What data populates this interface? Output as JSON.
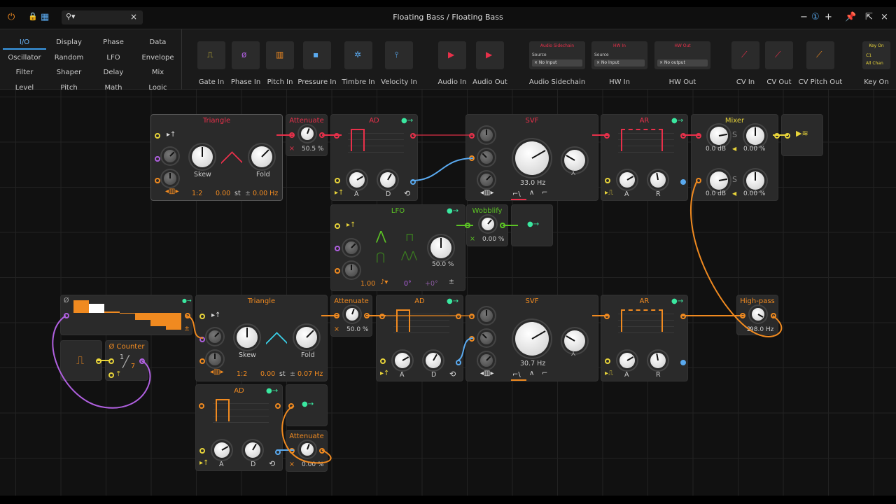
{
  "window": {
    "title": "Floating Bass / Floating Bass",
    "zoom_minus": "−",
    "zoom_plus": "+",
    "close": "×"
  },
  "colors": {
    "red": "#e8304a",
    "orange": "#f08a20",
    "green": "#5cc424",
    "yellow": "#e8d43a",
    "teal": "#3ae8a0",
    "purple": "#b060e0",
    "blue": "#5aaaf0",
    "accent": "#3a9be8"
  },
  "search": {
    "value": "",
    "clear": "×"
  },
  "browser": {
    "categories": [
      "I/O",
      "Display",
      "Phase",
      "Data",
      "Oscillator",
      "Random",
      "LFO",
      "Envelope",
      "Filter",
      "Shaper",
      "Delay",
      "Mix",
      "Level",
      "Pitch",
      "Math",
      "Logic"
    ],
    "modules": [
      "Gate In",
      "Phase In",
      "Pitch In",
      "Pressure In",
      "Timbre In",
      "Velocity In",
      "Audio In",
      "Audio Out",
      "Audio Sidechain",
      "HW In",
      "HW Out",
      "CV In",
      "CV Out",
      "CV Pitch Out",
      "Key On"
    ],
    "sidechain": {
      "title": "Audio Sidechain",
      "source": "Source",
      "value": "× No Input"
    },
    "hwin": {
      "title": "HW In",
      "source": "Source",
      "value": "× No Input"
    },
    "hwout": {
      "title": "HW Out",
      "value": "× No output"
    },
    "keyon": {
      "title": "Key On",
      "note": "C1",
      "chan": "All Chan"
    }
  },
  "modules": {
    "tri1": {
      "title": "Triangle",
      "skew": "Skew",
      "fold": "Fold",
      "ratio": "1:2",
      "semis": "0.00",
      "st": "st",
      "pm": "±",
      "hz": "0.00 Hz"
    },
    "att1": {
      "title": "Attenuate",
      "x": "×",
      "value": "50.5 %"
    },
    "ad1": {
      "title": "AD",
      "a": "A",
      "d": "D"
    },
    "lfo": {
      "title": "LFO",
      "rate": "1.00",
      "phase": "0°",
      "offset": "+0°",
      "pm": "±",
      "amount": "50.0 %"
    },
    "wob": {
      "title": "Wobblify",
      "x": "×",
      "value": "0.00 %"
    },
    "svf1": {
      "title": "SVF",
      "freq": "33.0 Hz"
    },
    "ar1": {
      "title": "AR",
      "a": "A",
      "r": "R"
    },
    "mixer": {
      "title": "Mixer",
      "g1": "0.0 dB",
      "p1": "0.00 %",
      "g2": "0.0 dB",
      "p2": "0.00 %",
      "s": "S"
    },
    "steps": {
      "phase": "Ø",
      "pm": "±"
    },
    "counter": {
      "title": "Ø Counter",
      "num": "1",
      "den": "7"
    },
    "tri2": {
      "title": "Triangle",
      "skew": "Skew",
      "fold": "Fold",
      "ratio": "1:2",
      "semis": "0.00",
      "st": "st",
      "pm": "±",
      "hz": "0.07 Hz"
    },
    "att2": {
      "title": "Attenuate",
      "x": "×",
      "value": "50.0 %"
    },
    "ad2": {
      "title": "AD",
      "a": "A",
      "d": "D"
    },
    "svf2": {
      "title": "SVF",
      "freq": "30.7 Hz"
    },
    "ar2": {
      "title": "AR",
      "a": "A",
      "r": "R"
    },
    "hp": {
      "title": "High-pass",
      "order": "2",
      "value": "98.0 Hz"
    },
    "ad3": {
      "title": "AD",
      "a": "A",
      "d": "D"
    },
    "att3": {
      "title": "Attenuate",
      "x": "×",
      "value": "0.00 %"
    }
  }
}
